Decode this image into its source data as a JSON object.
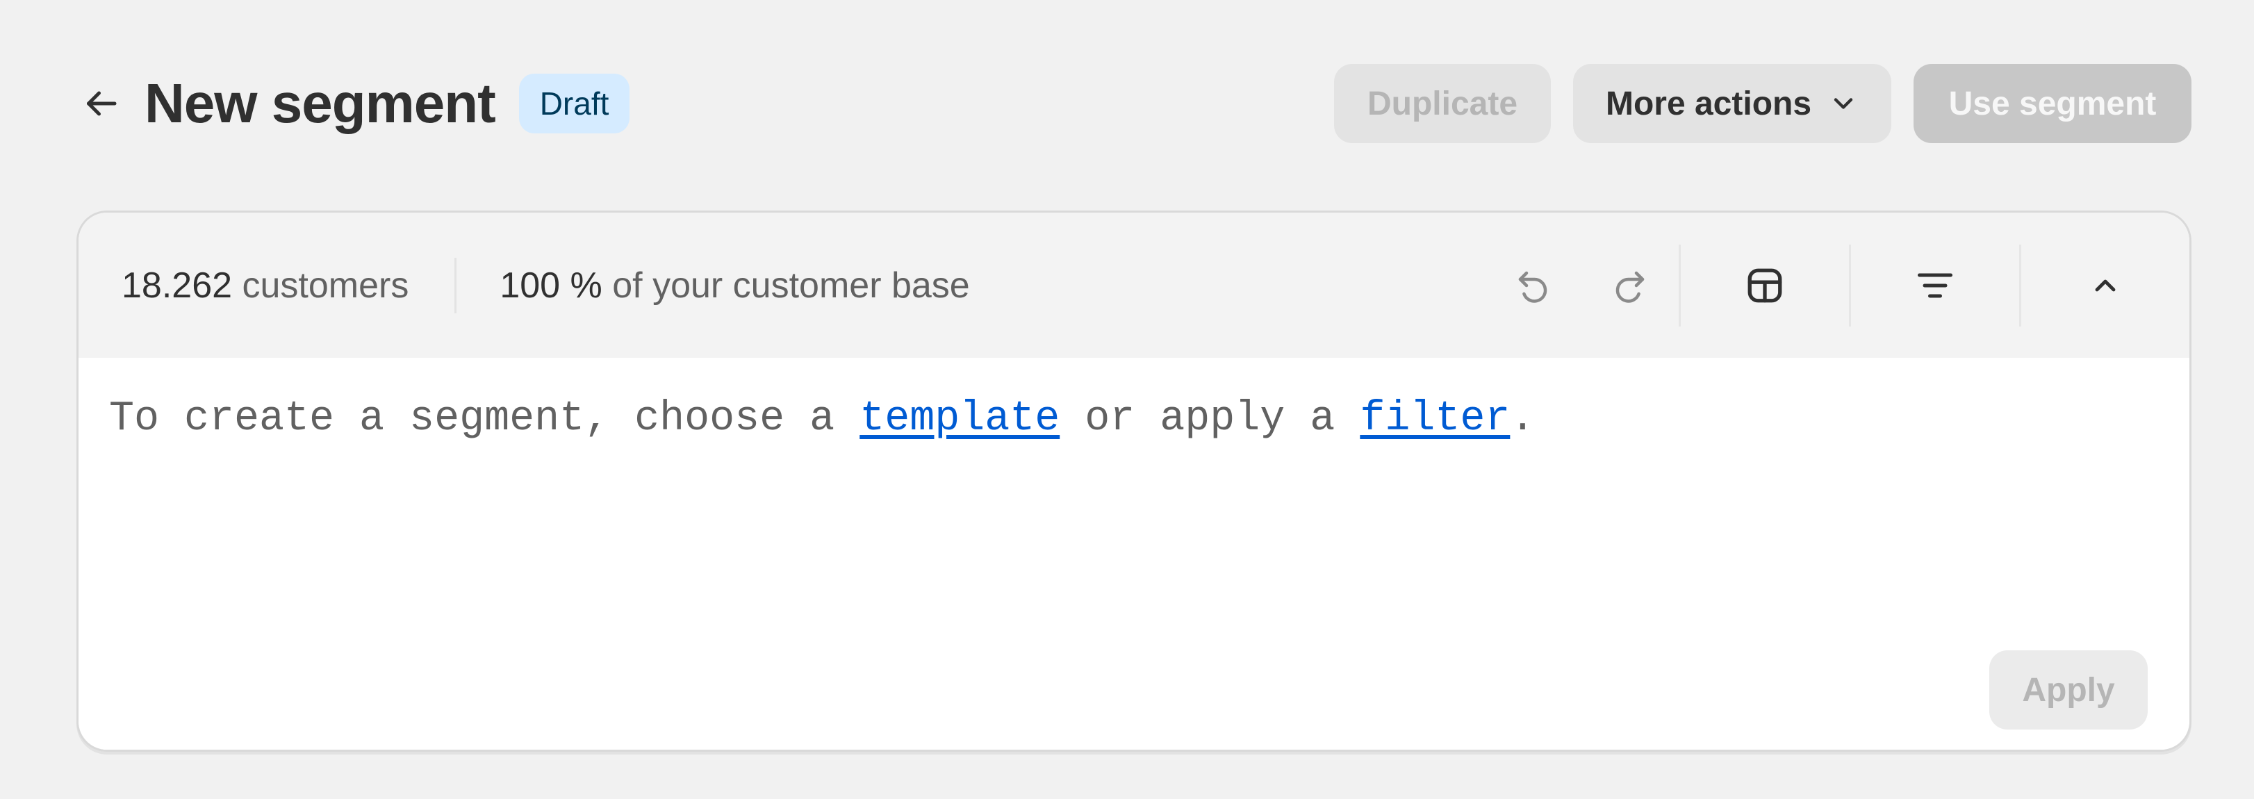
{
  "header": {
    "title": "New segment",
    "status_badge": "Draft",
    "duplicate_label": "Duplicate",
    "more_actions_label": "More actions",
    "use_segment_label": "Use segment"
  },
  "summary": {
    "customer_count": "18.262",
    "customer_label": "customers",
    "percent": "100 %",
    "percent_label": "of your customer base"
  },
  "toolbar": {
    "icons": [
      "undo-icon",
      "redo-icon",
      "template-icon",
      "filter-icon",
      "chevron-up-icon"
    ]
  },
  "editor": {
    "prefix": "To create a segment, choose a ",
    "template_link": "template",
    "middle": " or apply a ",
    "filter_link": "filter",
    "suffix": "."
  },
  "footer": {
    "apply_label": "Apply"
  },
  "colors": {
    "background": "#f1f1f1",
    "badge_bg": "#d5ebff",
    "link": "#005bd3",
    "disabled_text": "#b5b5b5"
  }
}
